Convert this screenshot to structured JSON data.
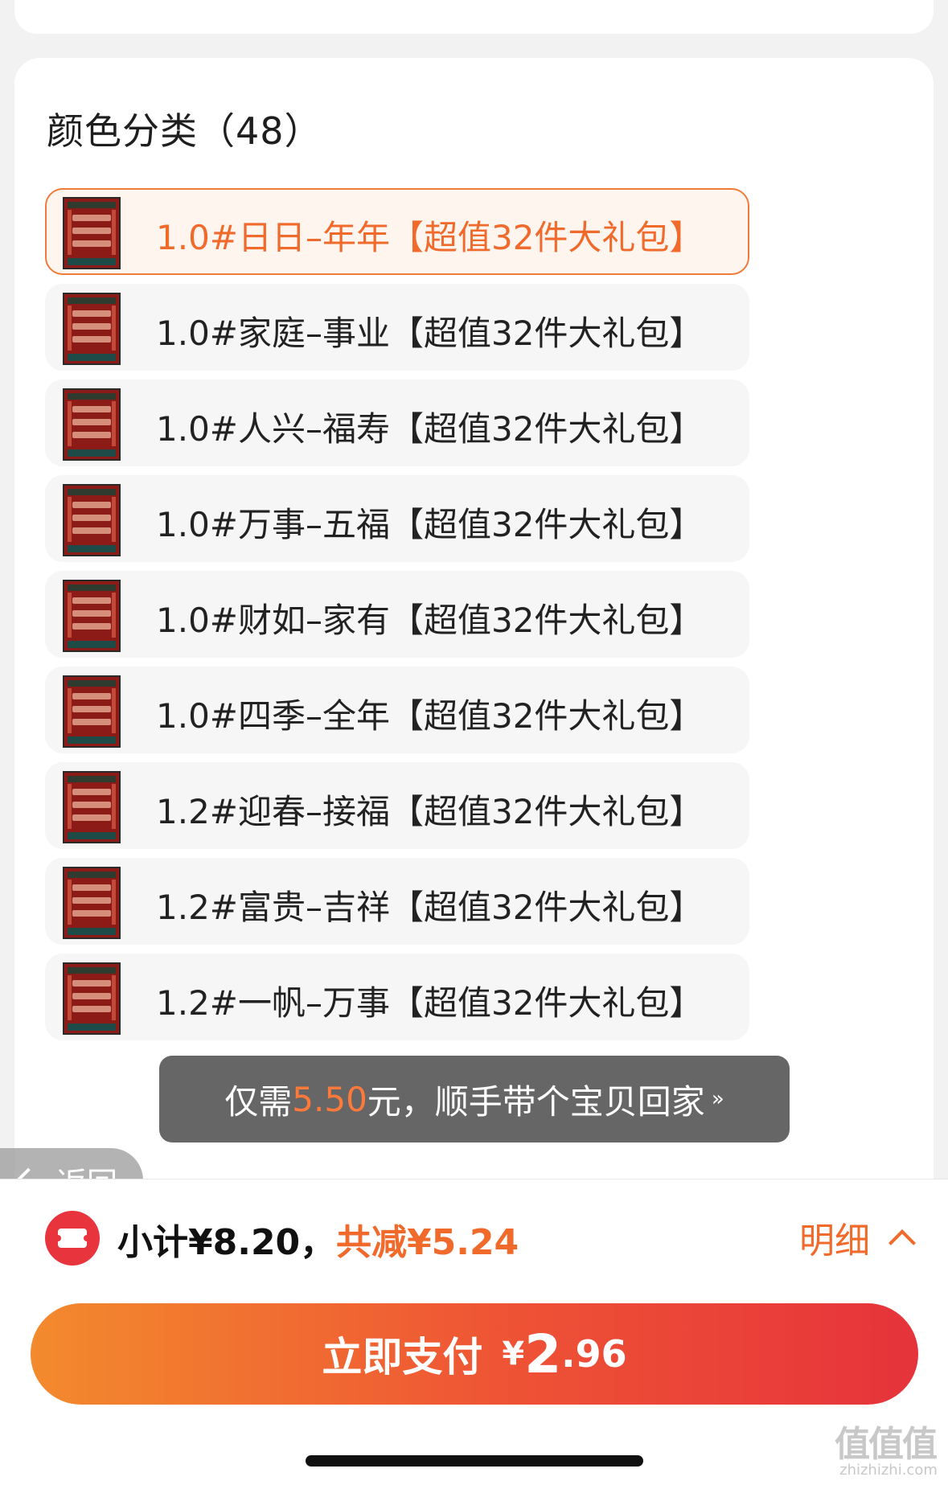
{
  "section": {
    "title": "颜色分类（48）"
  },
  "skus": [
    {
      "label": "1.0#日日–年年【超值32件大礼包】",
      "selected": true
    },
    {
      "label": "1.0#家庭–事业【超值32件大礼包】",
      "selected": false
    },
    {
      "label": "1.0#人兴–福寿【超值32件大礼包】",
      "selected": false
    },
    {
      "label": "1.0#万事–五福【超值32件大礼包】",
      "selected": false
    },
    {
      "label": "1.0#财如–家有【超值32件大礼包】",
      "selected": false
    },
    {
      "label": "1.0#四季–全年【超值32件大礼包】",
      "selected": false
    },
    {
      "label": "1.2#迎春–接福【超值32件大礼包】",
      "selected": false
    },
    {
      "label": "1.2#富贵–吉祥【超值32件大礼包】",
      "selected": false
    },
    {
      "label": "1.2#一帆–万事【超值32件大礼包】",
      "selected": false
    }
  ],
  "toast": {
    "prefix": "仅需",
    "price": "5.50",
    "suffix": "元，顺手带个宝贝回家",
    "chevron": "»"
  },
  "back": {
    "label": "返回"
  },
  "summary": {
    "subtotal": "小计¥8.20，",
    "discount": "共减¥5.24",
    "detail_label": "明细"
  },
  "pay": {
    "label": "立即支付",
    "currency": "¥",
    "integer": "2",
    "decimal": ".96"
  },
  "watermark": {
    "main": "值值值",
    "sub": "zhizhizhi.com"
  },
  "colors": {
    "accent": "#f06a2c",
    "pay_start": "#f38a2d",
    "pay_end": "#e6333b"
  }
}
